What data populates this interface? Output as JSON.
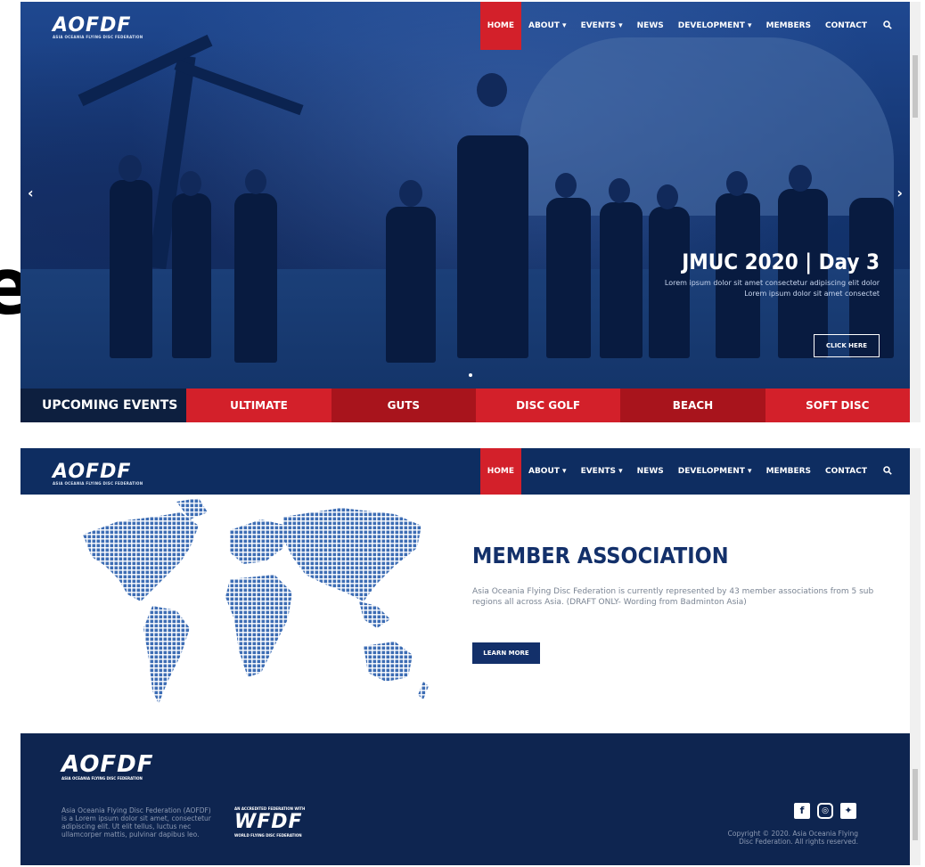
{
  "page": {
    "edge_letter": "e"
  },
  "nav": {
    "logo_text": "AOFDF",
    "logo_sub": "ASIA OCEANIA FLYING DISC FEDERATION",
    "items": [
      {
        "label": "HOME"
      },
      {
        "label": "ABOUT ▾"
      },
      {
        "label": "EVENTS ▾"
      },
      {
        "label": "NEWS"
      },
      {
        "label": "DEVELOPMENT ▾"
      },
      {
        "label": "MEMBERS"
      },
      {
        "label": "CONTACT"
      }
    ],
    "search_icon": "search-icon"
  },
  "hero": {
    "title": "JMUC 2020 | Day 3",
    "text": "Lorem ipsum dolor sit amet consectetur adipiscing elit dolor Lorem ipsum dolor sit amet consectet",
    "button": "CLICK HERE",
    "prev": "‹",
    "next": "›"
  },
  "events": {
    "label": "UPCOMING EVENTS",
    "items": [
      "ULTIMATE",
      "GUTS",
      "DISC GOLF",
      "BEACH",
      "SOFT DISC"
    ]
  },
  "member": {
    "title": "MEMBER ASSOCIATION",
    "text": "Asia Oceania Flying Disc Federation is currently represented by 43 member associations from 5 sub regions all across Asia. (DRAFT ONLY- Wording from Badminton Asia)",
    "button": "LEARN MORE"
  },
  "footer": {
    "logo_text": "AOFDF",
    "logo_sub": "ASIA OCEANIA FLYING DISC FEDERATION",
    "about": "Asia Oceania Flying Disc Federation (AOFDF) is a Lorem ipsum dolor sit amet, consectetur adipiscing elit. Ut elit tellus, luctus nec ullamcorper mattis, pulvinar dapibus leo.",
    "wfdf_pre": "AN ACCREDITED FEDERATION WITH",
    "wfdf": "WFDF",
    "wfdf_post": "WORLD FLYING DISC FEDERATION",
    "copyright": "Copyright © 2020. Asia Oceania Flying Disc Federation. All rights reserved."
  },
  "colors": {
    "navy": "#0e2d61",
    "red": "#d3202a",
    "dark_red": "#a8141c",
    "footer": "#0e2550"
  }
}
